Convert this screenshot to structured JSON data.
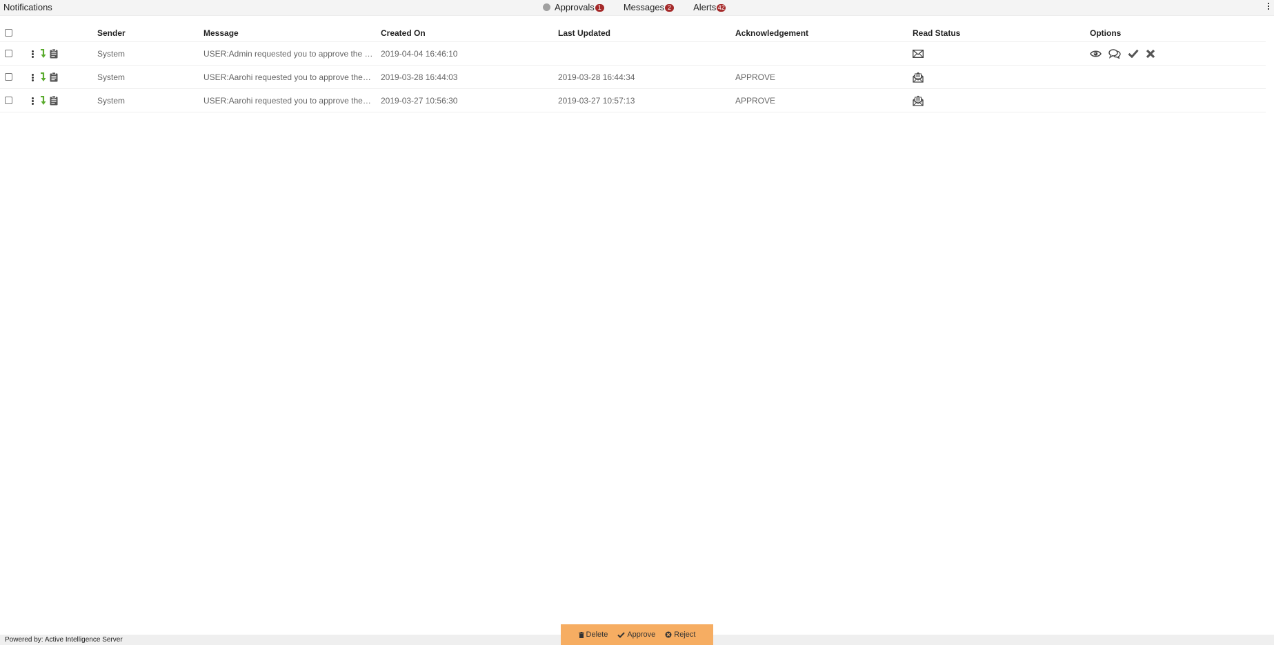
{
  "header": {
    "title": "Notifications",
    "tabs": [
      {
        "label": "Approvals",
        "badge": "1"
      },
      {
        "label": "Messages",
        "badge": "2"
      },
      {
        "label": "Alerts",
        "badge": "42"
      }
    ]
  },
  "table": {
    "columns": [
      "Sender",
      "Message",
      "Created On",
      "Last Updated",
      "Acknowledgement",
      "Read Status",
      "Options"
    ],
    "rows": [
      {
        "sender": "System",
        "message": "USER:Admin requested you to approve the …",
        "created_on": "2019-04-04 16:46:10",
        "last_updated": "",
        "acknowledgement": "",
        "read_status": "unread"
      },
      {
        "sender": "System",
        "message": "USER:Aarohi requested you to approve the …",
        "created_on": "2019-03-28 16:44:03",
        "last_updated": "2019-03-28 16:44:34",
        "acknowledgement": "APPROVE",
        "read_status": "read"
      },
      {
        "sender": "System",
        "message": "USER:Aarohi requested you to approve the …",
        "created_on": "2019-03-27 10:56:30",
        "last_updated": "2019-03-27 10:57:13",
        "acknowledgement": "APPROVE",
        "read_status": "read"
      }
    ]
  },
  "action_bar": {
    "delete_label": "Delete",
    "approve_label": "Approve",
    "reject_label": "Reject"
  },
  "footer": {
    "text": "Powered by: Active Intelligence Server"
  },
  "icons": {
    "row_actions": [
      "more-vert-icon",
      "arrow-turn-down-icon",
      "clipboard-icon"
    ],
    "options": [
      "eye-icon",
      "comments-icon",
      "check-icon",
      "times-icon"
    ],
    "read_status": {
      "unread": "envelope-closed-icon",
      "read": "envelope-open-icon"
    }
  },
  "colors": {
    "badge": "#a52a2a",
    "action_bar": "#f6ad62",
    "arrow_icon": "#5aab2e",
    "topbar": "#f4f4f4"
  }
}
